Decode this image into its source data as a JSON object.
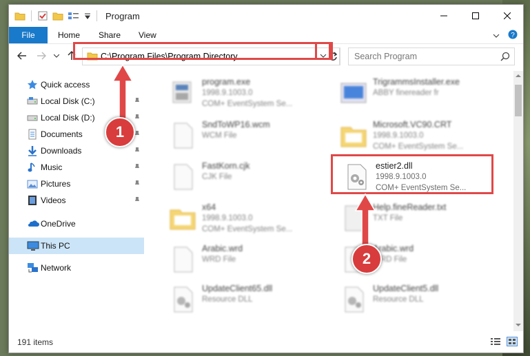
{
  "window": {
    "title": "Program"
  },
  "ribbon": {
    "tabs": [
      "File",
      "Home",
      "Share",
      "View"
    ]
  },
  "address": {
    "path": "C:\\Program Files\\Program Directory"
  },
  "search": {
    "placeholder": "Search Program"
  },
  "sidebar": {
    "items": [
      {
        "label": "Quick access",
        "icon": "star-icon",
        "pinned": false
      },
      {
        "label": "Local Disk (C:)",
        "icon": "drive-icon",
        "pinned": true
      },
      {
        "label": "Local Disk (D:)",
        "icon": "drive-icon",
        "pinned": true
      },
      {
        "label": "Documents",
        "icon": "documents-icon",
        "pinned": true
      },
      {
        "label": "Downloads",
        "icon": "download-icon",
        "pinned": true
      },
      {
        "label": "Music",
        "icon": "music-icon",
        "pinned": true
      },
      {
        "label": "Pictures",
        "icon": "pictures-icon",
        "pinned": true
      },
      {
        "label": "Videos",
        "icon": "videos-icon",
        "pinned": true
      },
      {
        "label": "OneDrive",
        "icon": "cloud-icon",
        "pinned": false
      },
      {
        "label": "This PC",
        "icon": "computer-icon",
        "pinned": false,
        "selected": true
      },
      {
        "label": "Network",
        "icon": "network-icon",
        "pinned": false
      }
    ]
  },
  "files": [
    {
      "name": "program.exe",
      "line2": "1998.9.1003.0",
      "line3": "COM+ EventSystem Se...",
      "icon": "exe-icon"
    },
    {
      "name": "TrigrammsInstaller.exe",
      "line2": "ABBY finereader fr",
      "line3": "",
      "icon": "installer-icon"
    },
    {
      "name": "SndToWP16.wcm",
      "line2": "WCM File",
      "line3": "",
      "icon": "file-icon"
    },
    {
      "name": "Microsoft.VC90.CRT",
      "line2": "1998.9.1003.0",
      "line3": "COM+ EventSystem Se...",
      "icon": "folder-icon"
    },
    {
      "name": "FastKorn.cjk",
      "line2": "CJK File",
      "line3": "",
      "icon": "file-icon"
    },
    {
      "name": "estier2.dll",
      "line2": "1998.9.1003.0",
      "line3": "COM+ EventSystem Se...",
      "icon": "dll-gear-icon"
    },
    {
      "name": "x64",
      "line2": "1998.9.1003.0",
      "line3": "COM+ EventSystem Se...",
      "icon": "folder-icon"
    },
    {
      "name": "Help.fineReader.txt",
      "line2": "TXT File",
      "line3": "",
      "icon": "file-icon"
    },
    {
      "name": "Arabic.wrd",
      "line2": "WRD File",
      "line3": "",
      "icon": "file-icon"
    },
    {
      "name": "Arabic.wrd",
      "line2": "WRD File",
      "line3": "",
      "icon": "file-icon"
    },
    {
      "name": "UpdateClient65.dll",
      "line2": "Resource DLL",
      "line3": "",
      "icon": "dll-gear-icon"
    },
    {
      "name": "UpdateClient5.dll",
      "line2": "Resource DLL",
      "line3": "",
      "icon": "dll-gear-icon"
    }
  ],
  "status": {
    "item_count": "191 items"
  },
  "callouts": {
    "step1": "1",
    "step2": "2"
  },
  "colors": {
    "accent": "#1979ca",
    "highlight": "#e04848",
    "callout": "#d83c3c",
    "selected": "#cce4f7"
  }
}
